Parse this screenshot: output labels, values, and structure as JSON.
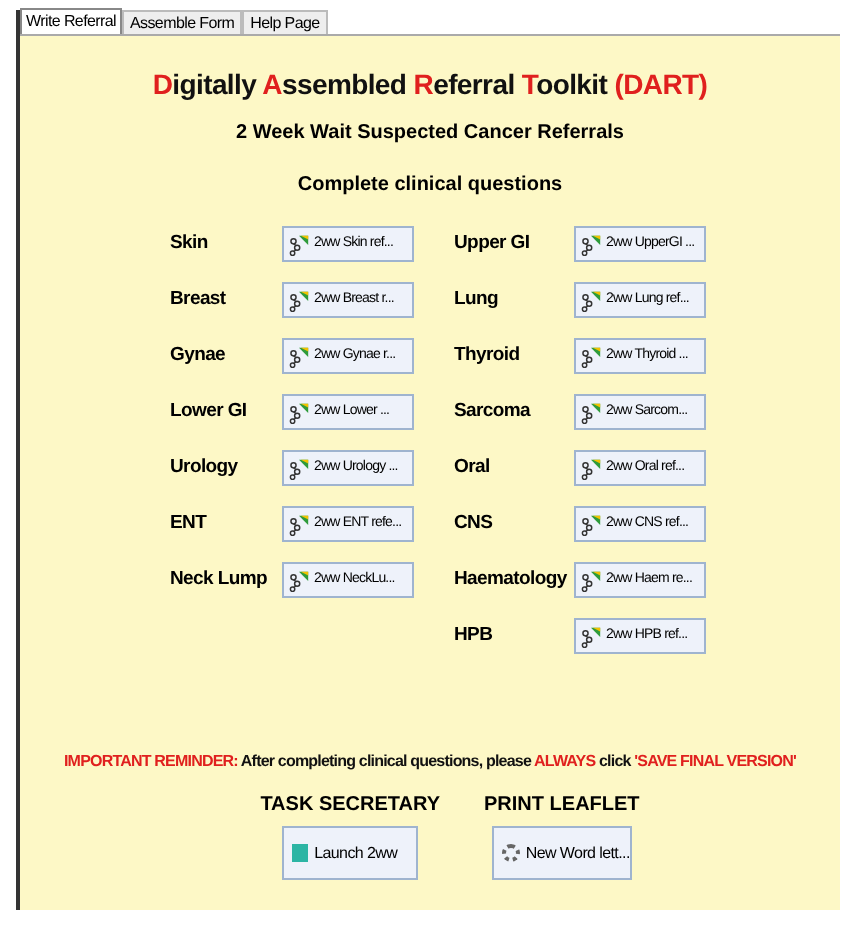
{
  "tabs": [
    {
      "label": "Write Referral",
      "selected": true
    },
    {
      "label": "Assemble Form",
      "selected": false
    },
    {
      "label": "Help Page",
      "selected": false
    }
  ],
  "title": [
    {
      "text": "D",
      "highlight": true
    },
    {
      "text": "igitally ",
      "highlight": false
    },
    {
      "text": "A",
      "highlight": true
    },
    {
      "text": "ssembled ",
      "highlight": false
    },
    {
      "text": "R",
      "highlight": true
    },
    {
      "text": "eferral ",
      "highlight": false
    },
    {
      "text": "T",
      "highlight": true
    },
    {
      "text": "oolkit ",
      "highlight": false
    },
    {
      "text": "(DART)",
      "highlight": true
    }
  ],
  "subtitle": "2 Week Wait Suspected Cancer Referrals",
  "section_heading": "Complete clinical questions",
  "left_column": [
    {
      "label": "Skin",
      "button": "2ww Skin ref..."
    },
    {
      "label": "Breast",
      "button": "2ww Breast r..."
    },
    {
      "label": "Gynae",
      "button": "2ww Gynae r..."
    },
    {
      "label": "Lower GI",
      "button": "2ww Lower ..."
    },
    {
      "label": "Urology",
      "button": "2ww Urology ..."
    },
    {
      "label": "ENT",
      "button": "2ww ENT refe..."
    },
    {
      "label": "Neck Lump",
      "button": "2ww NeckLu..."
    }
  ],
  "right_column": [
    {
      "label": "Upper GI",
      "button": "2ww UpperGI ..."
    },
    {
      "label": "Lung",
      "button": "2ww Lung ref..."
    },
    {
      "label": "Thyroid",
      "button": "2ww Thyroid ..."
    },
    {
      "label": "Sarcoma",
      "button": "2ww Sarcom..."
    },
    {
      "label": "Oral",
      "button": "2ww Oral ref..."
    },
    {
      "label": "CNS",
      "button": "2ww CNS ref..."
    },
    {
      "label": "Haematology",
      "button": "2ww Haem re..."
    },
    {
      "label": "HPB",
      "button": "2ww HPB ref..."
    }
  ],
  "reminder": [
    {
      "text": "IMPORTANT REMINDER:",
      "highlight": true
    },
    {
      "text": " After completing clinical questions, please ",
      "highlight": false
    },
    {
      "text": "ALWAYS",
      "highlight": true
    },
    {
      "text": " click ",
      "highlight": false
    },
    {
      "text": "'SAVE FINAL VERSION'",
      "highlight": true
    }
  ],
  "actions": [
    {
      "heading": "TASK SECRETARY",
      "button": "Launch 2ww",
      "kind": "square"
    },
    {
      "heading": "PRINT LEAFLET",
      "button": "New Word lett...",
      "kind": "gear"
    }
  ]
}
